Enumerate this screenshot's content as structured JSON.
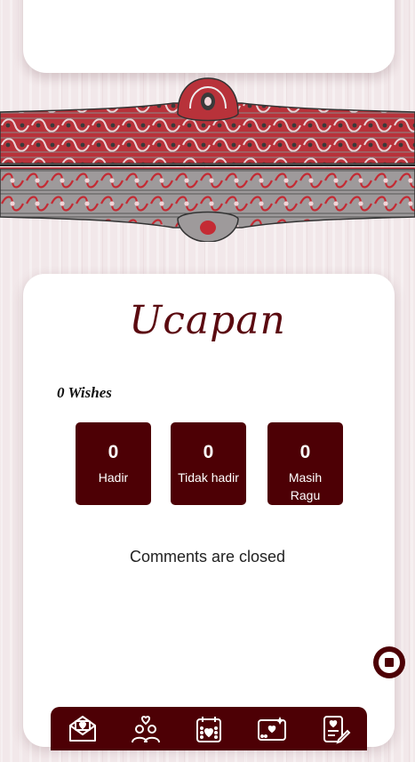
{
  "colors": {
    "accent": "#4d0005",
    "title": "#5b0a10",
    "background": "#f2e8ea"
  },
  "section": {
    "title": "Ucapan",
    "wishes_count": "0 Wishes",
    "comments_status": "Comments are closed"
  },
  "stats": [
    {
      "value": "0",
      "label": "Hadir"
    },
    {
      "value": "0",
      "label": "Tidak hadir"
    },
    {
      "value": "0",
      "label": "Masih Ragu"
    }
  ],
  "music_button": {
    "icon": "stop-icon"
  },
  "nav": [
    {
      "icon": "envelope-icon"
    },
    {
      "icon": "couple-icon"
    },
    {
      "icon": "calendar-icon"
    },
    {
      "icon": "gallery-icon"
    },
    {
      "icon": "guestbook-icon"
    }
  ]
}
